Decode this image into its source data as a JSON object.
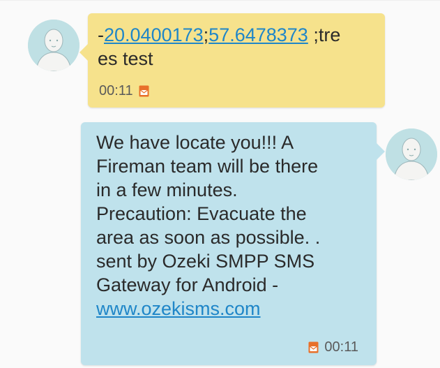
{
  "messages": [
    {
      "direction": "incoming",
      "text_prefix": "-",
      "link_1": "20.0400173",
      "separator": ";",
      "link_2": "57.6478373",
      "text_suffix": " ;tre\nes test",
      "time": "00:11",
      "status_icon": "sms-icon",
      "avatar_icon": "contact-avatar-icon"
    },
    {
      "direction": "outgoing",
      "text": "We have locate you!!! A\nFireman team will be there\nin a few minutes.\nPrecaution: Evacuate the\narea as soon as possible. .\nsent by Ozeki SMPP SMS\nGateway for Android -\n",
      "link": "www.ozekisms.com",
      "time": "00:11",
      "status_icon": "sms-icon",
      "avatar_icon": "contact-avatar-icon"
    }
  ],
  "colors": {
    "incoming_bubble": "#f6e28c",
    "outgoing_bubble": "#bfe2ec",
    "link": "#1f86c8",
    "avatar_bg": "#bfe0e4",
    "sms_icon": "#e8702a"
  }
}
